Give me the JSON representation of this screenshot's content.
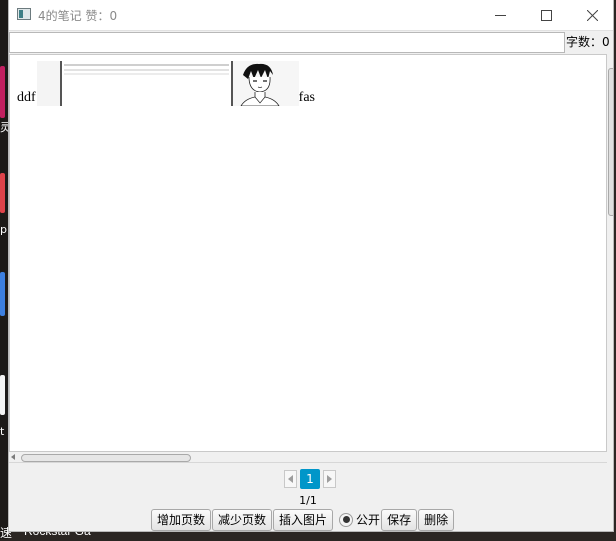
{
  "window": {
    "title": "4的笔记 赞：0"
  },
  "header": {
    "search_value": "",
    "char_count_label": "字数：0"
  },
  "editor": {
    "text_before": "ddf",
    "text_after": "fas",
    "images": [
      "screenshot-image",
      "portrait-image"
    ]
  },
  "pagination": {
    "current_page": "1",
    "indicator": "1/1"
  },
  "toolbar": {
    "add_page": "增加页数",
    "remove_page": "减少页数",
    "insert_image": "插入图片",
    "public_label": "公开",
    "public_selected": true,
    "save": "保存",
    "delete": "删除"
  },
  "desktop": {
    "taskbar_label": "Rockstar Ga",
    "taskbar_label_prefix": "速",
    "dock_labels": [
      "灵",
      "ph",
      "t"
    ]
  },
  "colors": {
    "accent": "#0096c9",
    "window_bg": "#f0f0f0",
    "title_text": "#8a8a8a"
  }
}
